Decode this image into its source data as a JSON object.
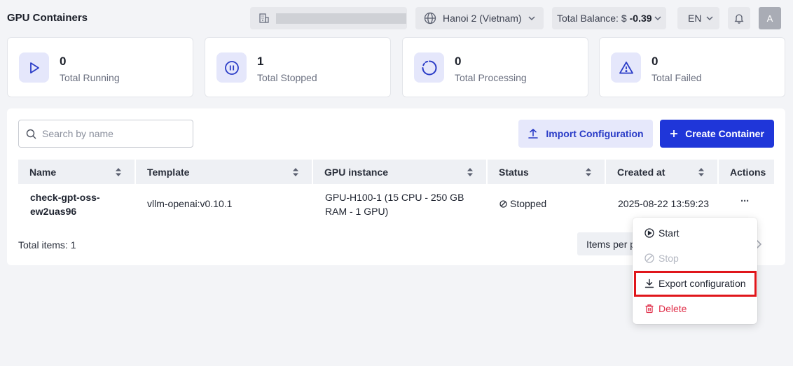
{
  "page": {
    "title": "GPU Containers"
  },
  "topbar": {
    "region": "Hanoi 2 (Vietnam)",
    "balance_label": "Total Balance: $",
    "balance_value": "-0.39",
    "language": "EN",
    "avatar_initial": "A"
  },
  "stats": [
    {
      "value": "0",
      "label": "Total Running",
      "icon": "play-icon"
    },
    {
      "value": "1",
      "label": "Total Stopped",
      "icon": "pause-icon"
    },
    {
      "value": "0",
      "label": "Total Processing",
      "icon": "processing-icon"
    },
    {
      "value": "0",
      "label": "Total Failed",
      "icon": "warning-icon"
    }
  ],
  "toolbar": {
    "search_placeholder": "Search by name",
    "import_label": "Import Configuration",
    "create_label": "Create Container"
  },
  "table": {
    "columns": [
      "Name",
      "Template",
      "GPU instance",
      "Status",
      "Created at",
      "Actions"
    ],
    "rows": [
      {
        "name_line1": "check-gpt-oss-",
        "name_line2": "ew2uas96",
        "template": "vllm-openai:v0.10.1",
        "gpu_line1": "GPU-H100-1 (15 CPU - 250 GB",
        "gpu_line2": "RAM - 1 GPU)",
        "status": "Stopped",
        "created_at": "2025-08-22 13:59:23",
        "actions": "···"
      }
    ],
    "total_items": "Total items: 1",
    "items_per_page": "Items per p"
  },
  "menu": {
    "start": "Start",
    "stop": "Stop",
    "export": "Export configuration",
    "delete": "Delete"
  },
  "colors": {
    "primary": "#1f36d9",
    "primary_light": "#e6e8fb",
    "danger": "#e0304a",
    "highlight": "#e0161b"
  }
}
